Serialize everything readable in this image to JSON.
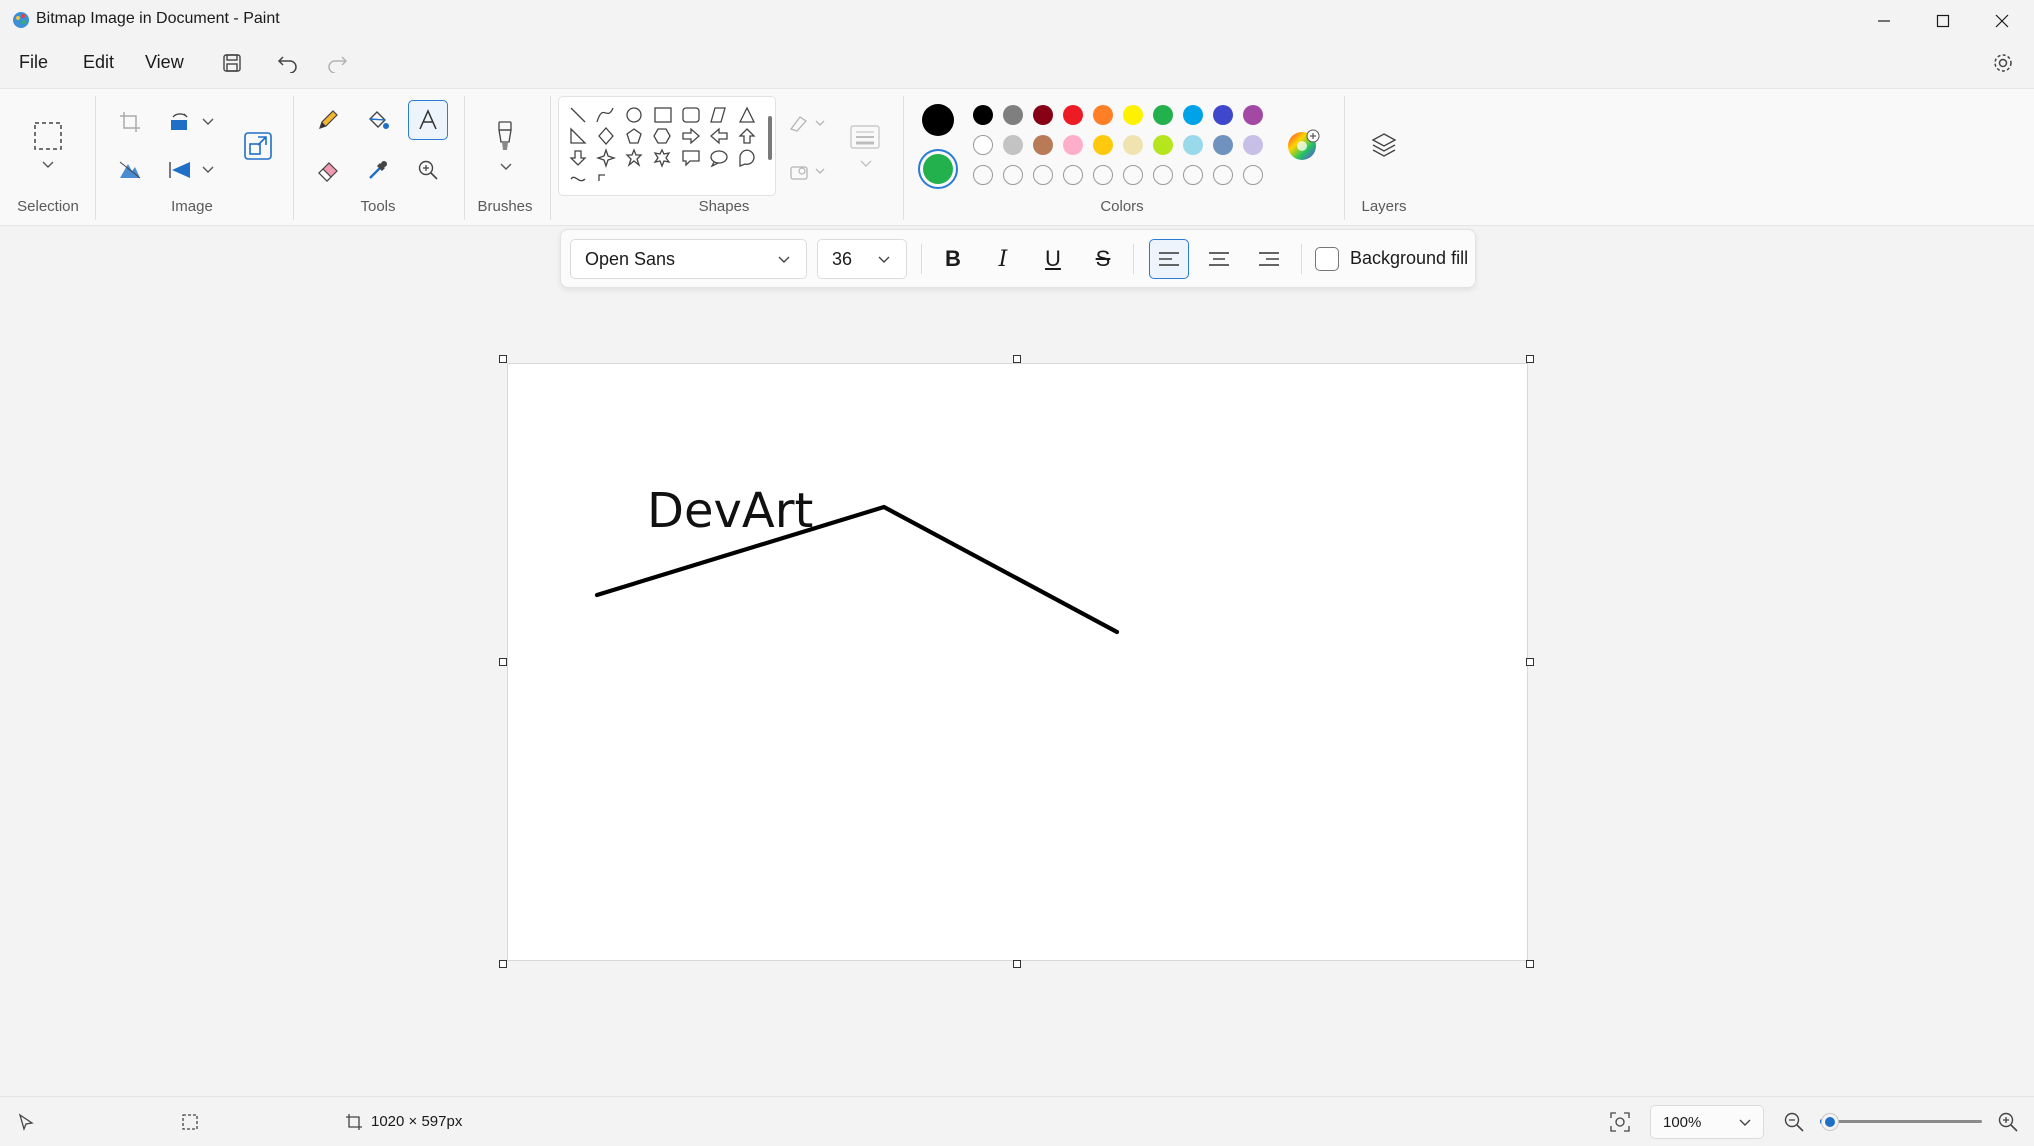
{
  "window": {
    "title": "Bitmap Image in Document - Paint"
  },
  "menu": {
    "file": "File",
    "edit": "Edit",
    "view": "View"
  },
  "ribbon": {
    "groups": {
      "selection": "Selection",
      "image": "Image",
      "tools": "Tools",
      "brushes": "Brushes",
      "shapes": "Shapes",
      "colors": "Colors",
      "layers": "Layers"
    },
    "colors": {
      "primary": "#000000",
      "secondary": "#22b14c",
      "row1": [
        "#000000",
        "#7f7f7f",
        "#880015",
        "#ed1c24",
        "#ff7f27",
        "#fff200",
        "#22b14c",
        "#00a2e8",
        "#3f48cc",
        "#a349a4"
      ],
      "row2": [
        "#ffffff",
        "#c3c3c3",
        "#b97a57",
        "#ffaec9",
        "#ffc90e",
        "#efe4b0",
        "#b5e61d",
        "#99d9ea",
        "#7092be",
        "#c8bfe7"
      ],
      "row3_empty_count": 10
    }
  },
  "text_toolbar": {
    "font_family": "Open Sans",
    "font_size": "36",
    "bold": "B",
    "italic": "I",
    "underline": "U",
    "strikethrough": "S",
    "background_fill": "Background fill"
  },
  "canvas": {
    "text": "DevArt"
  },
  "status": {
    "canvas_size": "1020 × 597px",
    "zoom": "100%",
    "zoom_level": 0.06
  }
}
